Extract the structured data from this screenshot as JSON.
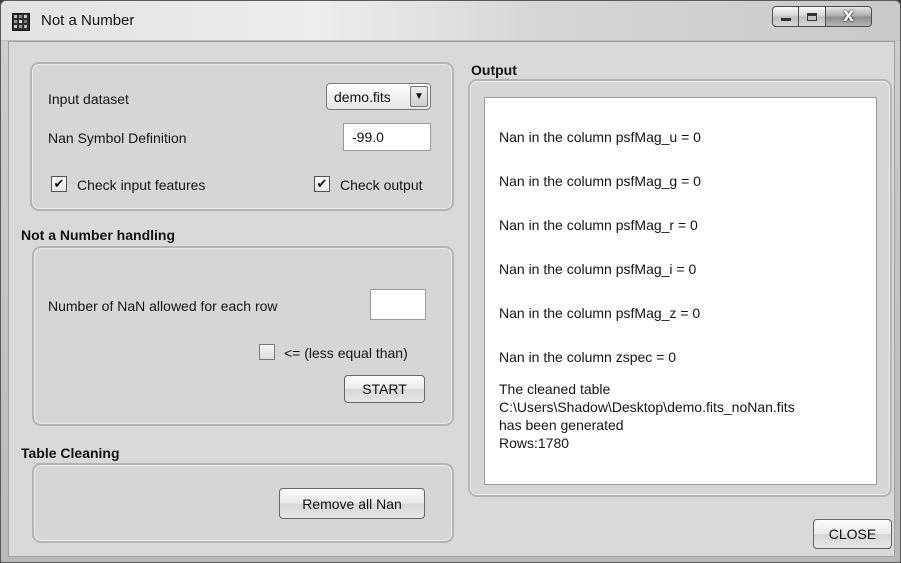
{
  "window": {
    "title": "Not a Number",
    "app_icon": "grid-app-icon",
    "controls": [
      "minimize-icon",
      "maximize-icon",
      "close-icon"
    ]
  },
  "input_section": {
    "dataset_label": "Input dataset",
    "dataset_value": "demo.fits",
    "nan_symbol_label": "Nan Symbol Definition",
    "nan_symbol_value": "-99.0",
    "check_input_label": "Check input features",
    "check_input_checked": true,
    "check_output_label": "Check output",
    "check_output_checked": true
  },
  "nan_handling": {
    "title": "Not a Number handling",
    "allowed_label": "Number of NaN allowed for each row",
    "allowed_value": "",
    "less_equal_label": "<= (less equal than)",
    "less_equal_checked": false,
    "start_label": "START"
  },
  "table_cleaning": {
    "title": "Table Cleaning",
    "remove_label": "Remove all Nan"
  },
  "output": {
    "title": "Output",
    "lines": [
      "Nan in the column psfMag_u = 0",
      "Nan in the column psfMag_g = 0",
      "Nan in the column psfMag_r = 0",
      "Nan in the column psfMag_i = 0",
      "Nan in the column psfMag_z = 0",
      "Nan in the column zspec = 0"
    ],
    "result": [
      "The cleaned table",
      "C:\\Users\\Shadow\\Desktop\\demo.fits_noNan.fits",
      "has been generated",
      "Rows:1780"
    ]
  },
  "close_label": "CLOSE",
  "check_mark": "✔",
  "dropdown_arrow": "▼",
  "close_glyph": "X"
}
